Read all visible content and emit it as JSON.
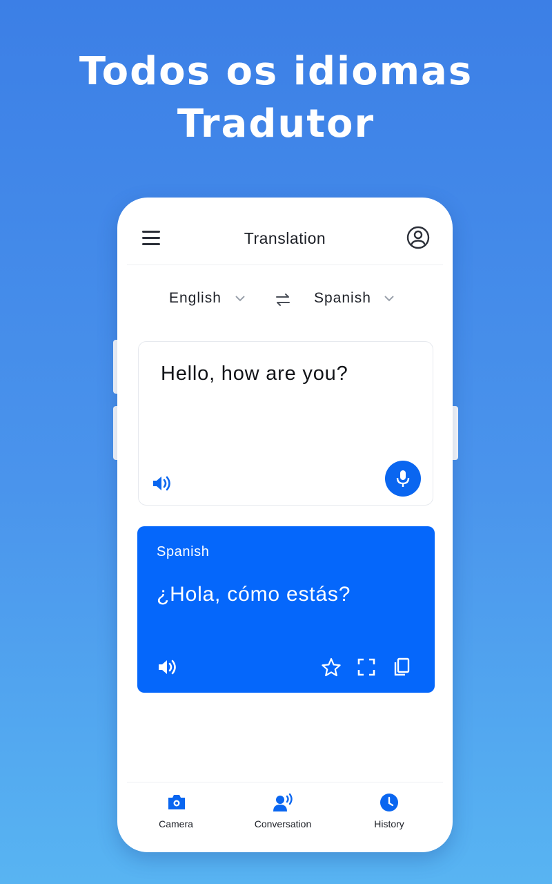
{
  "headline": {
    "line1": "Todos os idiomas",
    "line2": "Tradutor"
  },
  "appbar": {
    "title": "Translation",
    "menu_icon": "menu-icon",
    "profile_icon": "profile-icon"
  },
  "languages": {
    "source": "English",
    "target": "Spanish"
  },
  "input": {
    "text": "Hello, how are you?"
  },
  "output": {
    "language": "Spanish",
    "text": "¿Hola, cómo estás?"
  },
  "bottom_nav": {
    "items": [
      {
        "label": "Camera",
        "icon": "camera-icon"
      },
      {
        "label": "Conversation",
        "icon": "conversation-icon"
      },
      {
        "label": "History",
        "icon": "history-icon"
      }
    ]
  },
  "colors": {
    "background_top": "#3c7fe6",
    "background_bottom": "#58b4f2",
    "accent": "#0567fb"
  }
}
